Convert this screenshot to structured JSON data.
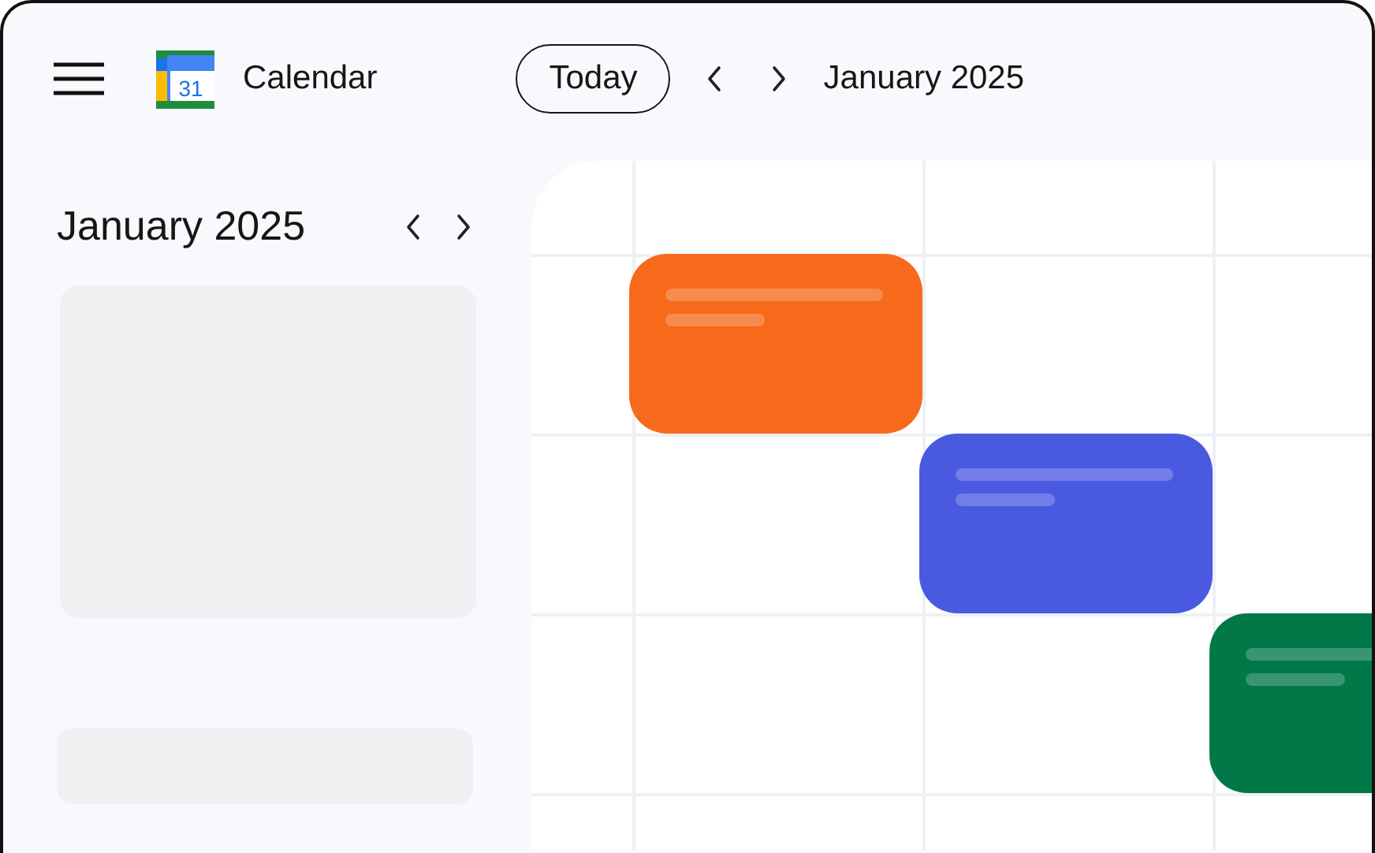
{
  "header": {
    "logo_day": "31",
    "app_title": "Calendar",
    "today_button": "Today",
    "current_period": "January 2025"
  },
  "sidebar": {
    "month_title": "January 2025"
  },
  "events": [
    {
      "color": "#f76a1b"
    },
    {
      "color": "#4a5ae0"
    },
    {
      "color": "#007848"
    }
  ]
}
